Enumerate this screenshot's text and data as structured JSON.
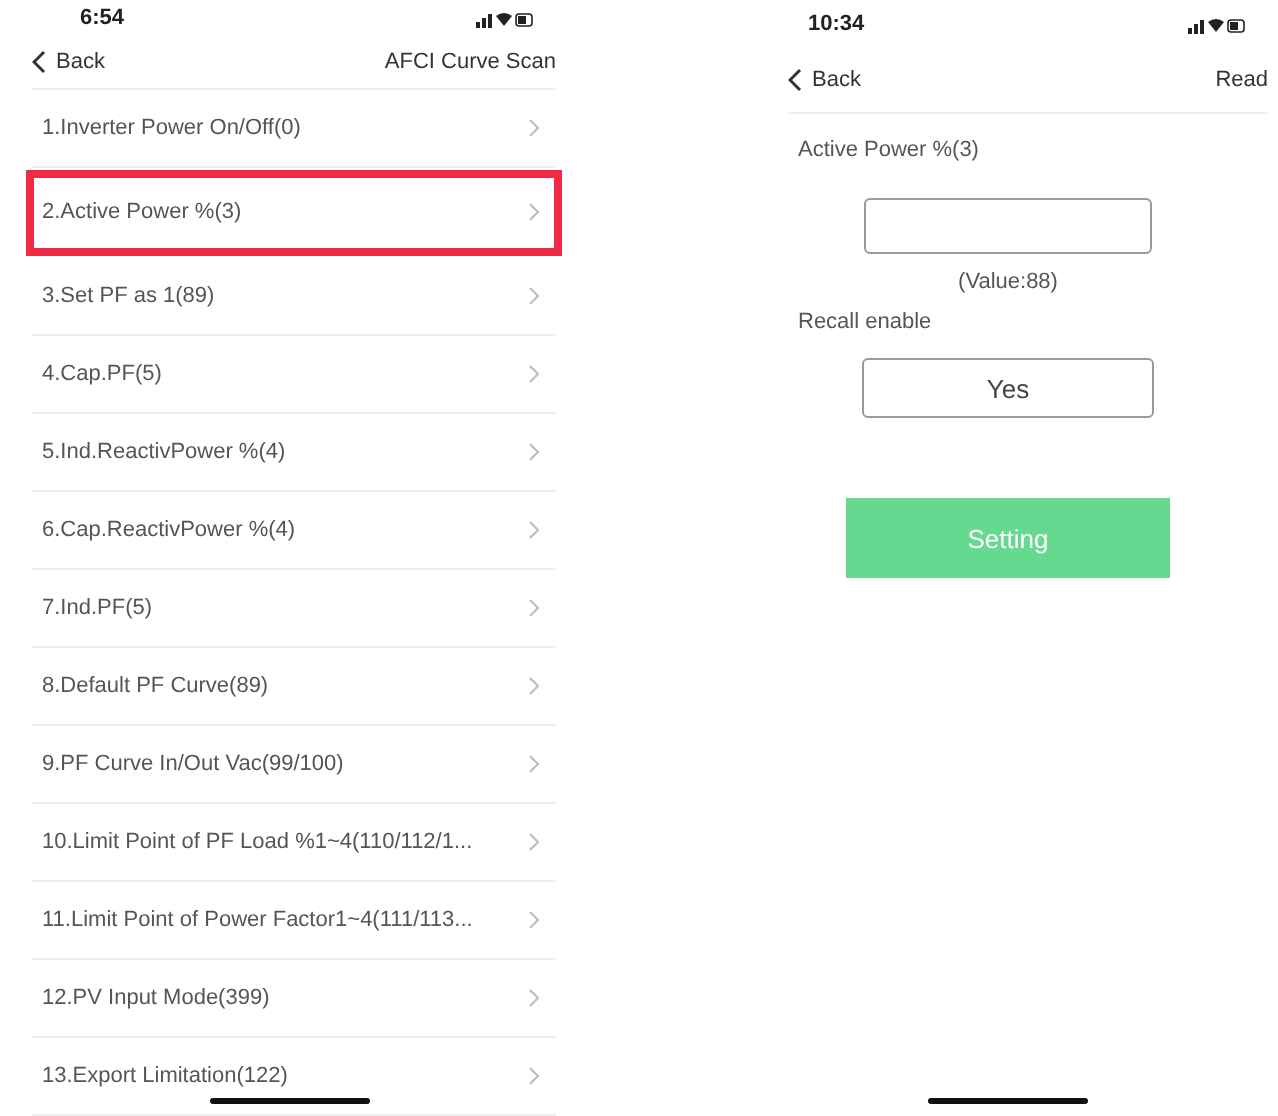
{
  "left_screen": {
    "status_bar": {
      "time": "6:54"
    },
    "nav": {
      "back": "Back",
      "title": "AFCI Curve Scan"
    },
    "items": [
      {
        "label": "1.Inverter Power On/Off(0)",
        "highlighted": false
      },
      {
        "label": "2.Active Power %(3)",
        "highlighted": true
      },
      {
        "label": "3.Set PF as 1(89)",
        "highlighted": false
      },
      {
        "label": "4.Cap.PF(5)",
        "highlighted": false
      },
      {
        "label": "5.Ind.ReactivPower %(4)",
        "highlighted": false
      },
      {
        "label": "6.Cap.ReactivPower %(4)",
        "highlighted": false
      },
      {
        "label": "7.Ind.PF(5)",
        "highlighted": false
      },
      {
        "label": "8.Default PF Curve(89)",
        "highlighted": false
      },
      {
        "label": "9.PF Curve In/Out Vac(99/100)",
        "highlighted": false
      },
      {
        "label": "10.Limit Point of PF Load %1~4(110/112/1...",
        "highlighted": false
      },
      {
        "label": "11.Limit Point of Power Factor1~4(111/113...",
        "highlighted": false
      },
      {
        "label": "12.PV Input Mode(399)",
        "highlighted": false
      },
      {
        "label": "13.Export Limitation(122)",
        "highlighted": false
      }
    ]
  },
  "right_screen": {
    "status_bar": {
      "time": "10:34"
    },
    "nav": {
      "back": "Back",
      "action": "Read"
    },
    "field_label": "Active Power %(3)",
    "value_note": "(Value:88)",
    "recall_label": "Recall enable",
    "recall_value": "Yes",
    "submit": "Setting"
  }
}
